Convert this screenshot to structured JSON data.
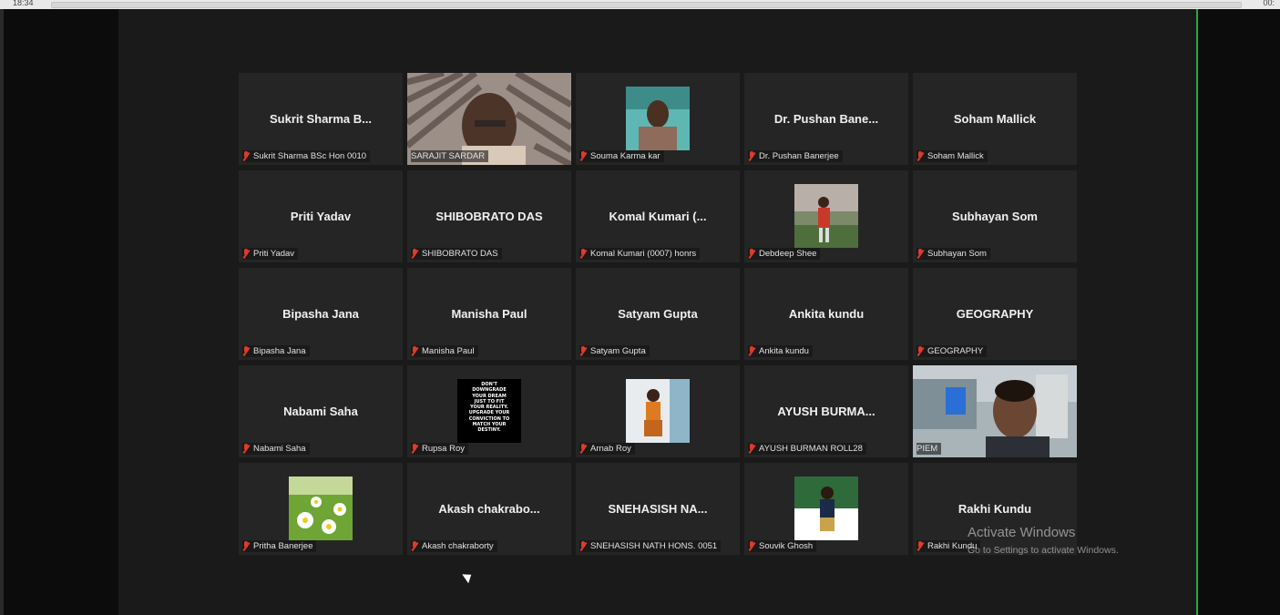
{
  "player": {
    "time_elapsed": "18:34",
    "time_remaining": "00:"
  },
  "gallery": {
    "tiles": [
      {
        "big": "Sukrit Sharma B...",
        "label": "Sukrit Sharma BSc Hon 0010"
      },
      {
        "big": "",
        "label": "SARAJIT SARDAR"
      },
      {
        "big": "",
        "label": "Souma Karma kar"
      },
      {
        "big": "Dr. Pushan Bane...",
        "label": "Dr. Pushan Banerjee"
      },
      {
        "big": "Soham Mallick",
        "label": "Soham Mallick"
      },
      {
        "big": "Priti Yadav",
        "label": "Priti Yadav"
      },
      {
        "big": "SHIBOBRATO DAS",
        "label": "SHIBOBRATO DAS"
      },
      {
        "big": "Komal Kumari (...",
        "label": "Komal Kumari (0007) honrs"
      },
      {
        "big": "",
        "label": "Debdeep Shee"
      },
      {
        "big": "Subhayan Som",
        "label": "Subhayan Som"
      },
      {
        "big": "Bipasha Jana",
        "label": "Bipasha Jana"
      },
      {
        "big": "Manisha Paul",
        "label": "Manisha Paul"
      },
      {
        "big": "Satyam Gupta",
        "label": "Satyam Gupta"
      },
      {
        "big": "Ankita kundu",
        "label": "Ankita kundu"
      },
      {
        "big": "GEOGRAPHY",
        "label": "GEOGRAPHY"
      },
      {
        "big": "Nabami Saha",
        "label": "Nabami Saha"
      },
      {
        "big": "",
        "label": "Rupsa Roy"
      },
      {
        "big": "",
        "label": "Arnab Roy"
      },
      {
        "big": "AYUSH BURMA...",
        "label": "AYUSH BURMAN ROLL28"
      },
      {
        "big": "",
        "label": "PIEM"
      },
      {
        "big": "",
        "label": "Pritha Banerjee"
      },
      {
        "big": "Akash chakrabo...",
        "label": "Akash chakraborty"
      },
      {
        "big": "SNEHASISH NA...",
        "label": "SNEHASISH NATH HONS. 0051"
      },
      {
        "big": "",
        "label": "Souvik Ghosh"
      },
      {
        "big": "Rakhi Kundu",
        "label": "Rakhi Kundu"
      }
    ],
    "quote_lines": [
      "DON'T",
      "DOWNGRADE",
      "YOUR DREAM",
      "JUST TO FIT",
      "YOUR REALITY.",
      "UPGRADE YOUR",
      "CONVICTION TO",
      "MATCH YOUR",
      "DESTINY."
    ]
  },
  "watermark": {
    "line1": "Activate Windows",
    "line2": "Go to Settings to activate Windows."
  }
}
